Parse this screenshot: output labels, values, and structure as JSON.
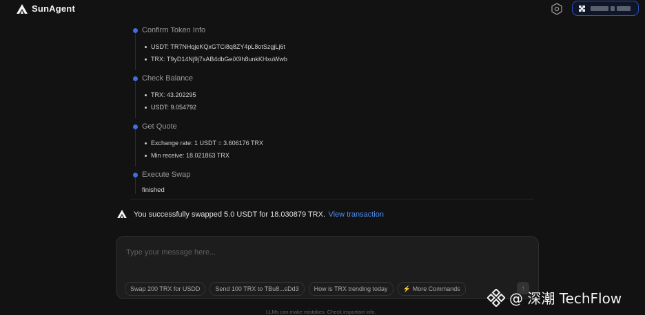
{
  "app": {
    "name": "SunAgent"
  },
  "header": {
    "settings_icon": "hexagon-gear-icon",
    "wallet_icon": "wallet-x-icon",
    "accent": "#2e4fb8"
  },
  "steps": [
    {
      "title": "Confirm Token Info",
      "details": [
        "USDT: TR7NHqjeKQxGTCi8q8ZY4pL8otSzgjLj6t",
        "TRX: T9yD14Nj9j7xAB4dbGeiX9h8unkKHxuWwb"
      ]
    },
    {
      "title": "Check Balance",
      "details": [
        "TRX: 43.202295",
        "USDT: 9.054792"
      ]
    },
    {
      "title": "Get Quote",
      "details": [
        "Exchange rate: 1 USDT = 3.606176 TRX",
        "Min receive: 18.021863 TRX"
      ]
    },
    {
      "title": "Execute Swap",
      "status": "finished"
    }
  ],
  "result": {
    "message": "You successfully swapped 5.0 USDT for 18.030879 TRX.",
    "link": "View transaction",
    "link_color": "#4d8df7"
  },
  "composer": {
    "placeholder": "Type your message here...",
    "suggestions": [
      "Swap 200 TRX for USDD",
      "Send 100 TRX to TBu8...sDd3",
      "How is TRX trending today"
    ],
    "more_commands": "More Commands",
    "send_icon": "arrow-up-icon"
  },
  "disclaimer": "LLMs can make mistakes. Check important info.",
  "watermark": {
    "text": "@ 深潮 TechFlow",
    "icon": "binance-diamond-icon"
  }
}
